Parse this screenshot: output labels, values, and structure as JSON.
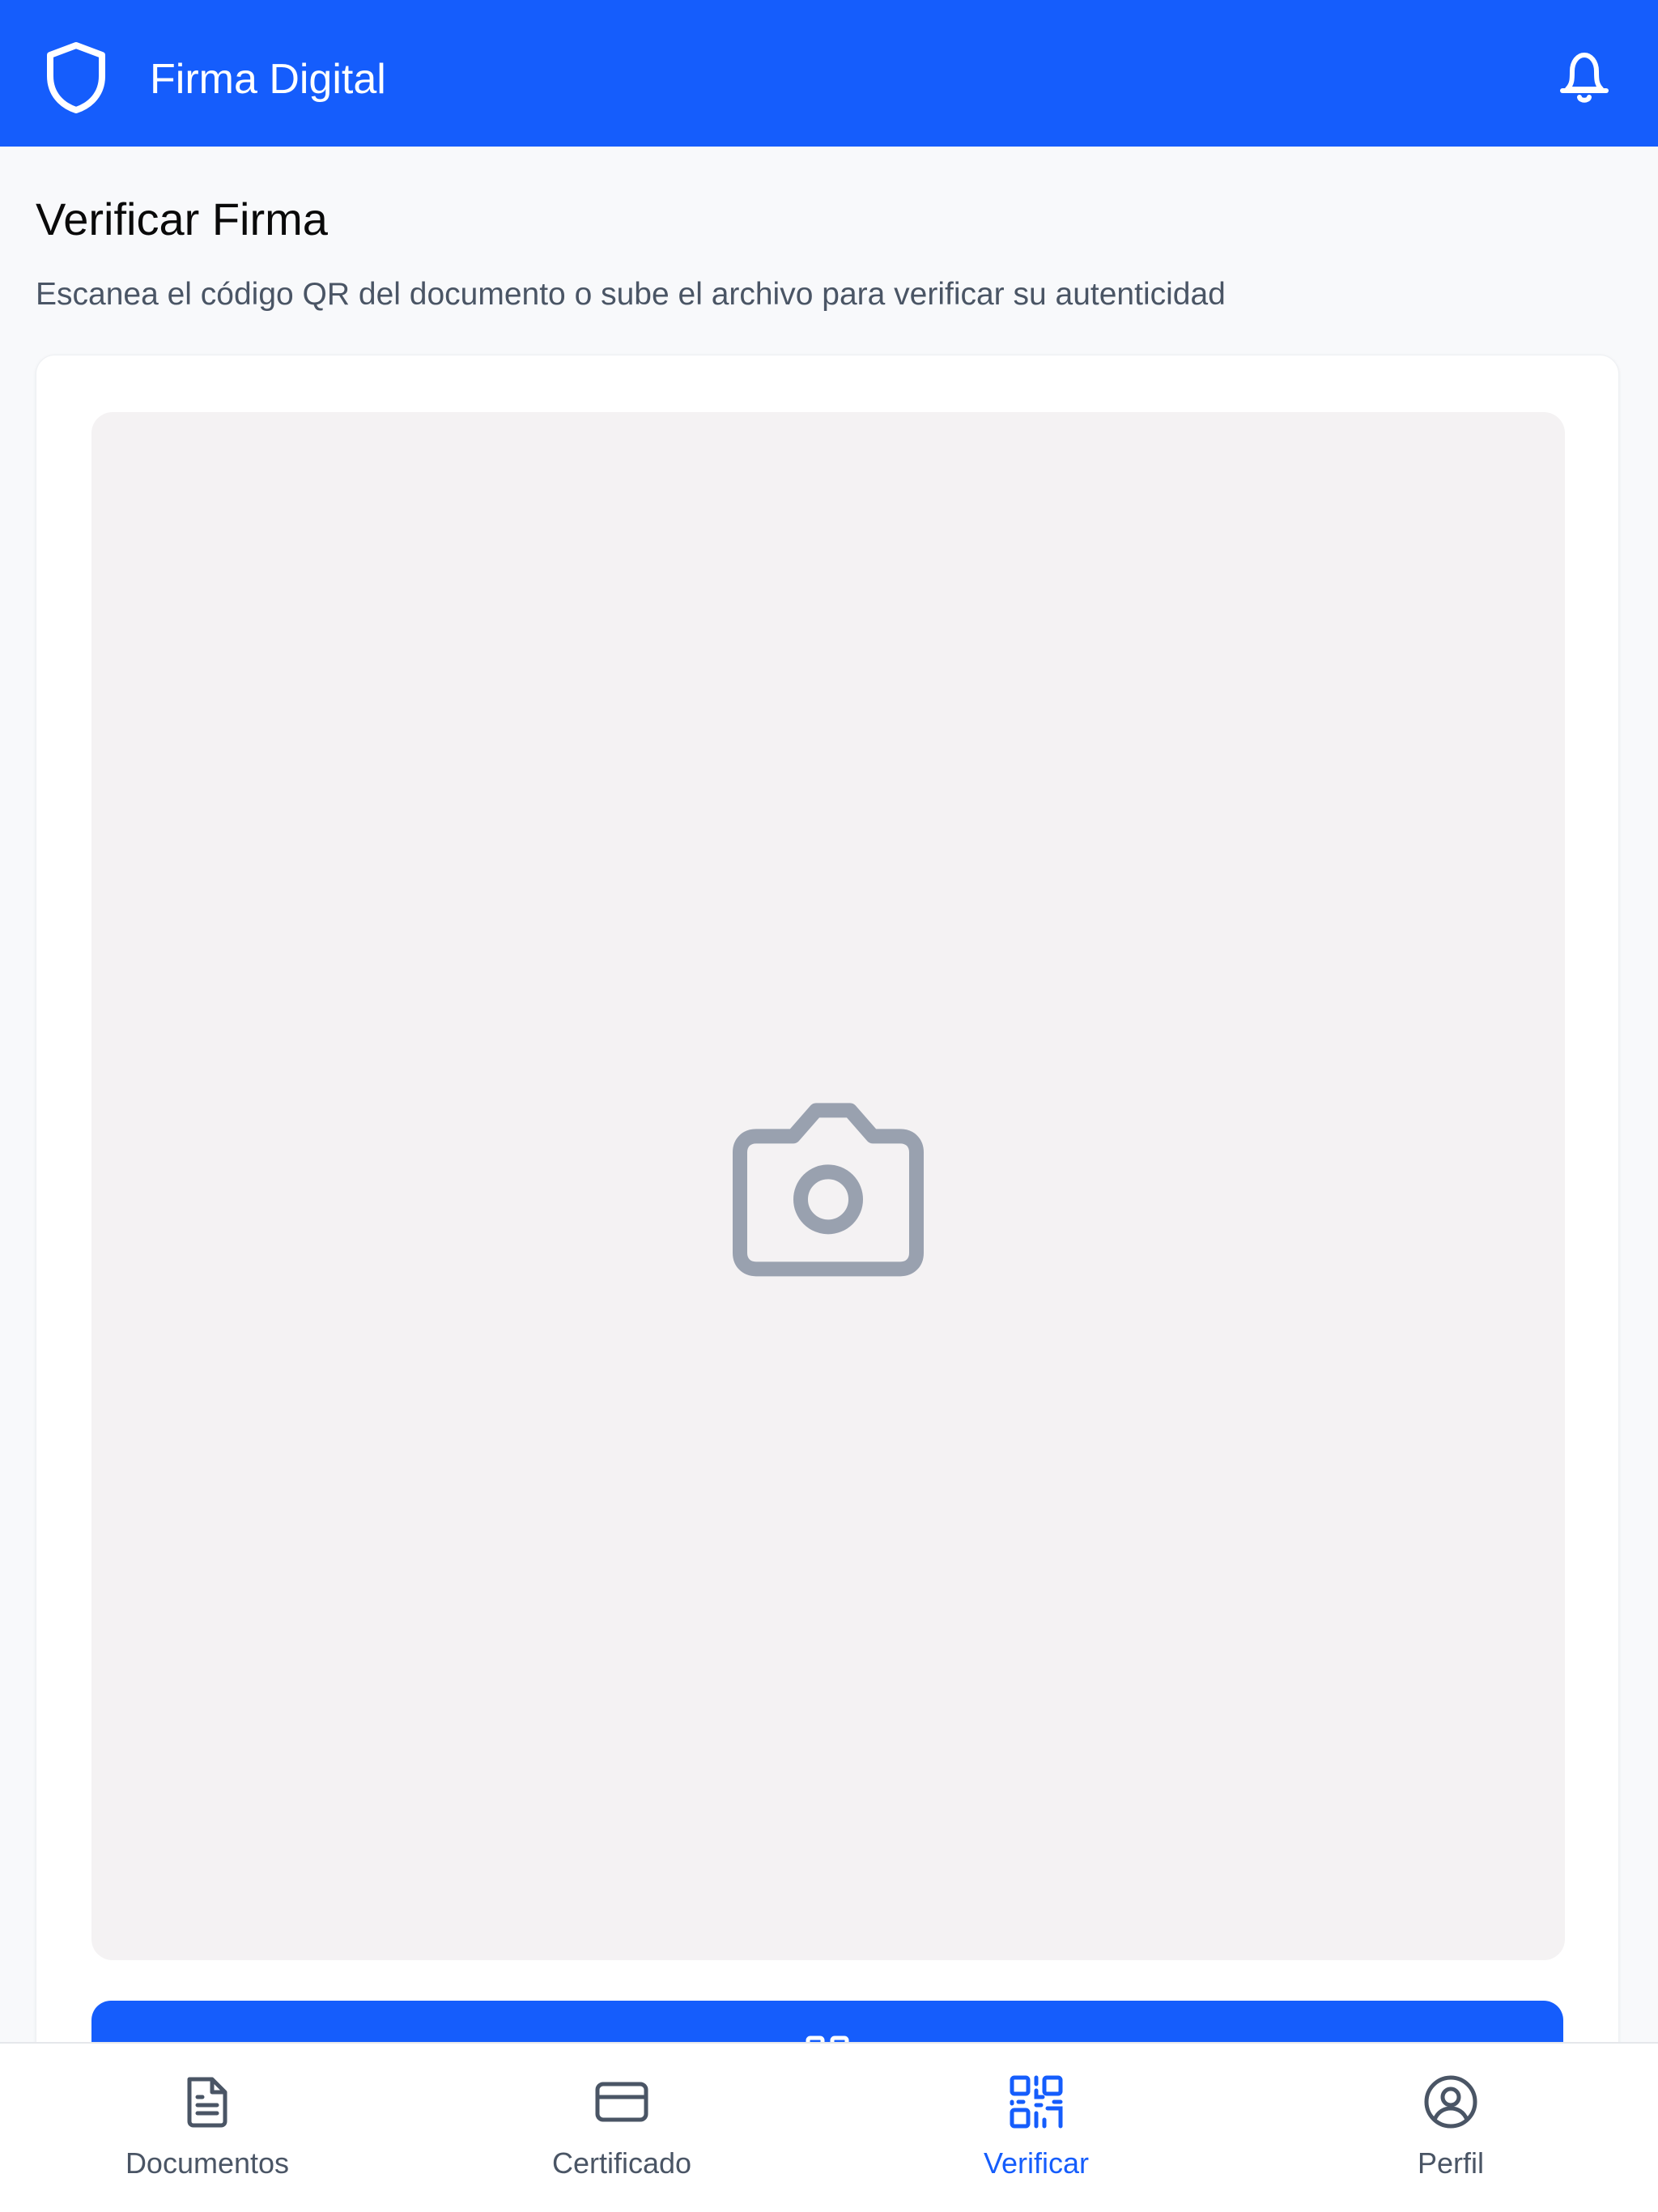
{
  "header": {
    "title": "Firma Digital",
    "logo_icon": "shield-icon",
    "notifications_icon": "bell-icon"
  },
  "page": {
    "title": "Verificar Firma",
    "subtitle": "Escanea el código QR del documento o sube el archivo para verificar su autenticidad"
  },
  "scanner": {
    "icon": "camera-icon",
    "button_icon": "qr-code-icon"
  },
  "nav": {
    "items": [
      {
        "label": "Documentos",
        "icon": "document-icon",
        "active": false
      },
      {
        "label": "Certificado",
        "icon": "card-icon",
        "active": false
      },
      {
        "label": "Verificar",
        "icon": "qr-code-icon",
        "active": true
      },
      {
        "label": "Perfil",
        "icon": "user-circle-icon",
        "active": false
      }
    ]
  },
  "colors": {
    "primary": "#155dfc",
    "background": "#f8f9fb",
    "scanner_bg": "#f4f2f3",
    "icon_gray": "#99a1af",
    "nav_text": "#4a5565"
  }
}
